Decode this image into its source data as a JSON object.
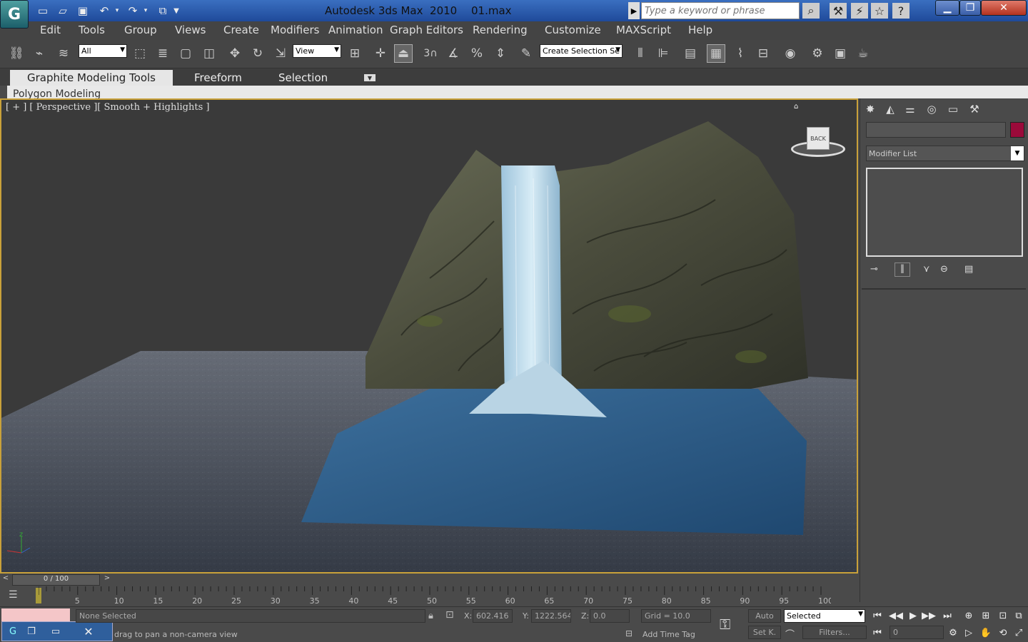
{
  "app": {
    "title": "Autodesk 3ds Max  2010",
    "file": "01.max",
    "logo_icon": "3dsmax-logo-icon"
  },
  "search": {
    "placeholder": "Type a keyword or phrase"
  },
  "menu": [
    "Edit",
    "Tools",
    "Group",
    "Views",
    "Create",
    "Modifiers",
    "Animation",
    "Graph Editors",
    "Rendering",
    "Customize",
    "MAXScript",
    "Help"
  ],
  "toolbar": {
    "filter_value": "All",
    "coord_value": "View",
    "selection_set_placeholder": "Create Selection Se",
    "snap_label": "3"
  },
  "ribbon": {
    "tabs": [
      "Graphite Modeling Tools",
      "Freeform",
      "Selection"
    ],
    "panel_label": "Polygon Modeling"
  },
  "viewport": {
    "label": "[ + ] [ Perspective ][ Smooth + Highlights ]",
    "viewcube_label": "BACK",
    "axis": {
      "x": "x",
      "y": "y",
      "z": "z"
    }
  },
  "command_panel": {
    "name_value": "",
    "modifier_list": "Modifier List",
    "color_swatch": "#9b0a3a"
  },
  "time_slider": {
    "value": "0 / 100",
    "left": "<",
    "right": ">"
  },
  "timeline": {
    "ticks": [
      "5",
      "10",
      "15",
      "20",
      "25",
      "30",
      "35",
      "40",
      "45",
      "50",
      "55",
      "60",
      "65",
      "70",
      "75",
      "80",
      "85",
      "90",
      "95",
      "100"
    ]
  },
  "status": {
    "selection": "None Selected",
    "prompt": "drag to pan a non-camera view",
    "x_label": "X:",
    "x_value": "602.416",
    "y_label": "Y:",
    "y_value": "1222.564",
    "z_label": "Z:",
    "z_value": "0.0",
    "grid": "Grid = 10.0",
    "add_time_tag": "Add Time Tag",
    "auto_key": "Auto",
    "set_key": "Set K.",
    "key_filter": "Selected",
    "filters": "Filters...",
    "frame": "0"
  },
  "colors": {
    "accent": "#c9a13a",
    "title_bar": "#2a5cb0",
    "water": "#3a6f9c"
  }
}
